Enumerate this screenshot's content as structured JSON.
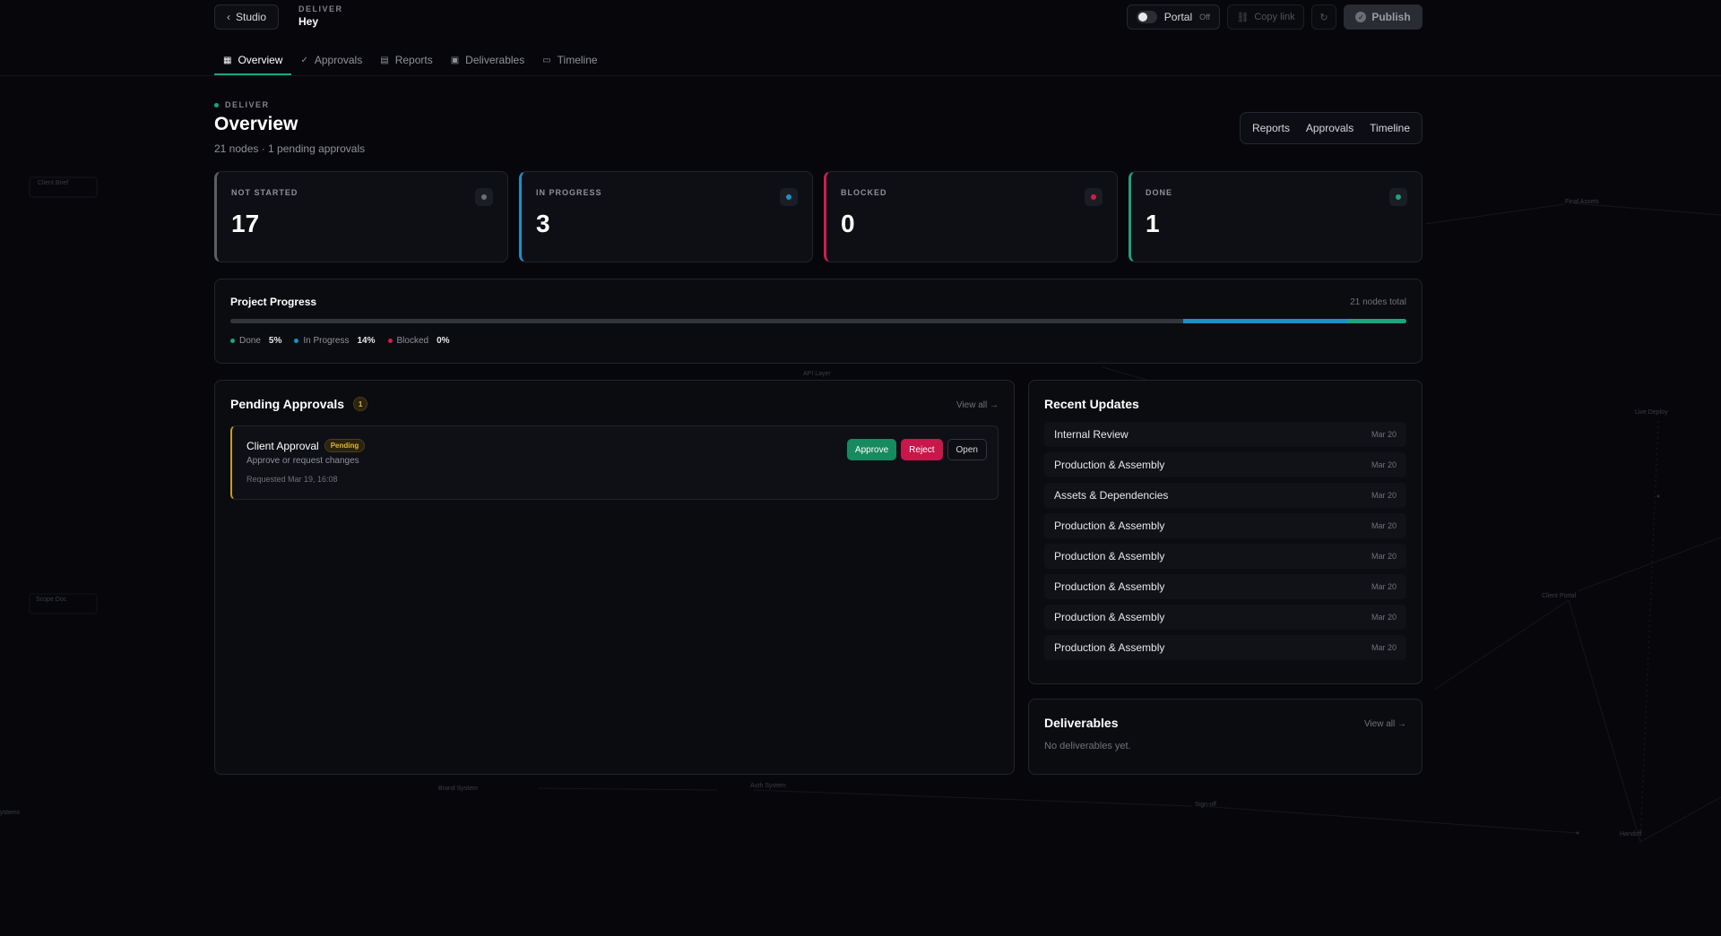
{
  "topbar": {
    "back_label": "Studio",
    "crumb_small": "DELIVER",
    "crumb_title": "Hey",
    "portal_label": "Portal",
    "portal_state": "Off",
    "copy_link_label": "Copy link",
    "publish_label": "Publish"
  },
  "tabs": [
    {
      "label": "Overview",
      "icon": "grid-icon",
      "active": true
    },
    {
      "label": "Approvals",
      "icon": "check-icon",
      "active": false
    },
    {
      "label": "Reports",
      "icon": "chart-icon",
      "active": false
    },
    {
      "label": "Deliverables",
      "icon": "box-icon",
      "active": false
    },
    {
      "label": "Timeline",
      "icon": "calendar-icon",
      "active": false
    }
  ],
  "header": {
    "kicker": "DELIVER",
    "title": "Overview",
    "subtitle": "21 nodes · 1 pending approvals",
    "quick_links": [
      "Reports",
      "Approvals",
      "Timeline"
    ]
  },
  "stats": [
    {
      "label": "NOT STARTED",
      "value": "17",
      "color": "#6b6e77"
    },
    {
      "label": "IN PROGRESS",
      "value": "3",
      "color": "#1c8fc8"
    },
    {
      "label": "BLOCKED",
      "value": "0",
      "color": "#d11d4e"
    },
    {
      "label": "DONE",
      "value": "1",
      "color": "#1fa37f"
    }
  ],
  "progress": {
    "title": "Project Progress",
    "total": "21 nodes total",
    "done_pct": 5,
    "in_progress_pct": 14,
    "blocked_pct": 0,
    "legend": [
      {
        "label": "Done",
        "value": "5%",
        "color": "#1fa37f"
      },
      {
        "label": "In Progress",
        "value": "14%",
        "color": "#1c8fc8"
      },
      {
        "label": "Blocked",
        "value": "0%",
        "color": "#d11d4e"
      }
    ]
  },
  "approvals": {
    "title": "Pending Approvals",
    "count": "1",
    "view_all": "View all →",
    "items": [
      {
        "name": "Client Approval",
        "status": "Pending",
        "description": "Approve or request changes",
        "requested": "Requested Mar 19, 16:08",
        "approve_label": "Approve",
        "reject_label": "Reject",
        "open_label": "Open"
      }
    ]
  },
  "updates": {
    "title": "Recent Updates",
    "items": [
      {
        "name": "Internal Review",
        "date": "Mar 20"
      },
      {
        "name": "Production & Assembly",
        "date": "Mar 20"
      },
      {
        "name": "Assets & Dependencies",
        "date": "Mar 20"
      },
      {
        "name": "Production & Assembly",
        "date": "Mar 20"
      },
      {
        "name": "Production & Assembly",
        "date": "Mar 20"
      },
      {
        "name": "Production & Assembly",
        "date": "Mar 20"
      },
      {
        "name": "Production & Assembly",
        "date": "Mar 20"
      },
      {
        "name": "Production & Assembly",
        "date": "Mar 20"
      }
    ]
  },
  "deliverables": {
    "title": "Deliverables",
    "view_all": "View all →",
    "empty": "No deliverables yet."
  },
  "background_nodes": [
    {
      "label": "Client Brief"
    },
    {
      "label": "Scope Doc"
    },
    {
      "label": "Final Assets"
    },
    {
      "label": "Live Deploy"
    },
    {
      "label": "Client Portal"
    },
    {
      "label": "Brand System"
    },
    {
      "label": "Auth System"
    },
    {
      "label": "Sign-off"
    },
    {
      "label": "Handoff"
    },
    {
      "label": "API Layer"
    },
    {
      "label": "ystems"
    }
  ]
}
